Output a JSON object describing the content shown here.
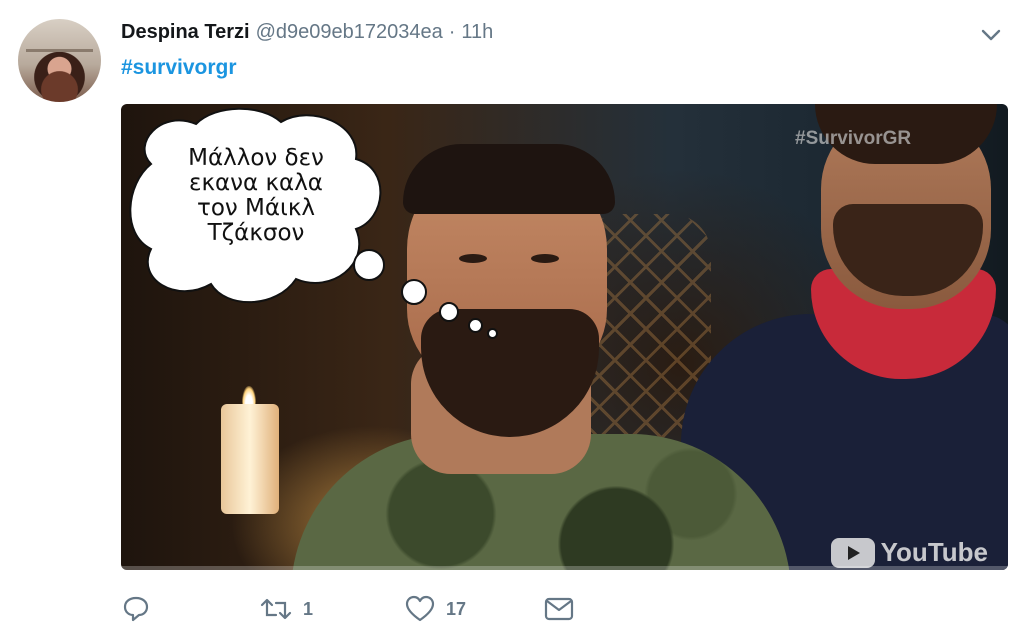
{
  "tweet": {
    "display_name": "Despina Terzi",
    "handle": "@d9e09eb172034ea",
    "separator": "·",
    "time": "11h",
    "hashtag": "#survivorgr",
    "image": {
      "speech_bubble_lines": [
        "Μάλλον δεν",
        "εκανα καλα",
        "τον Μάικλ",
        "Τζάκσον"
      ],
      "watermark": "#SurvivorGR",
      "youtube_logo_text": "YouTube"
    },
    "actions": {
      "retweet_count": "1",
      "like_count": "17"
    }
  },
  "icons": [
    "avatar",
    "chevron-down-icon",
    "reply-icon",
    "retweet-icon",
    "like-icon",
    "message-icon"
  ]
}
